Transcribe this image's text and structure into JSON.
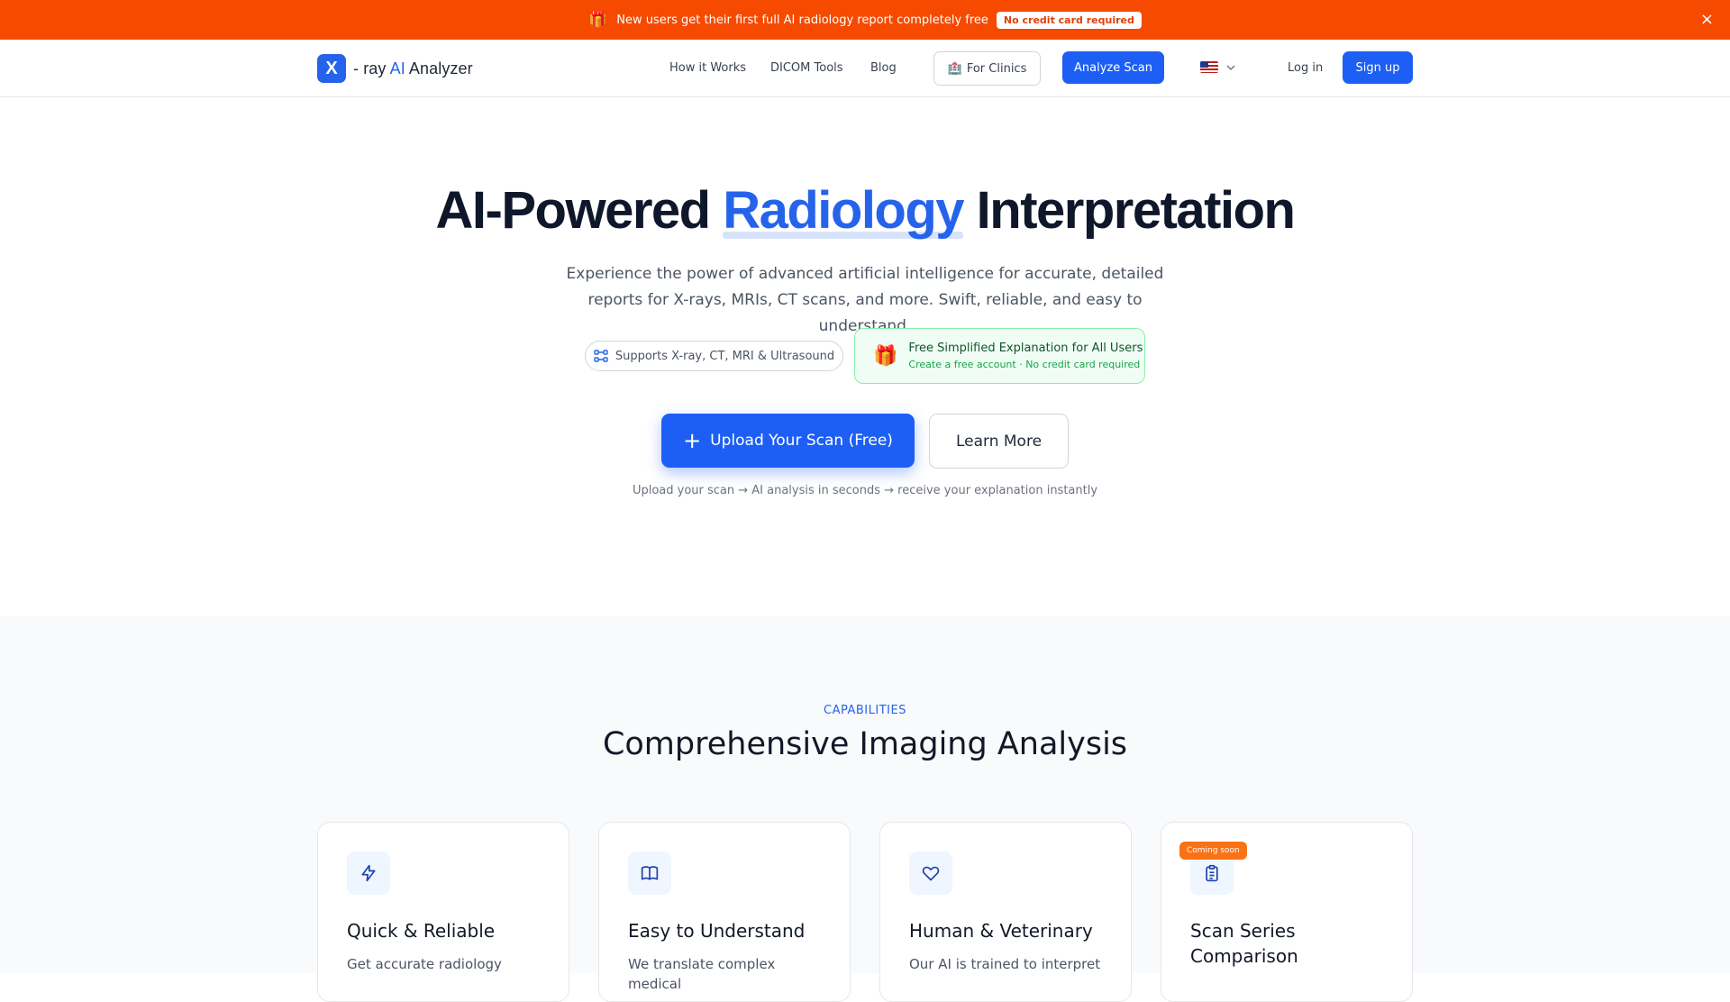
{
  "announcement": {
    "text": "New users get their first full AI radiology report completely free",
    "badge": "No credit card required",
    "close_glyph": "×"
  },
  "nav": {
    "logo_mark": "X",
    "logo_text_pre": "- ray ",
    "logo_text_ai": "AI",
    "logo_text_post": " Analyzer",
    "links": [
      "How it Works",
      "DICOM Tools",
      "Blog"
    ],
    "clinics_label": "For Clinics",
    "analyze_label": "Analyze Scan",
    "login_label": "Log in",
    "signup_label": "Sign up"
  },
  "hero": {
    "title_pre": "AI-Powered ",
    "title_highlight": "Radiology",
    "title_post": " Interpretation",
    "subtitle": "Experience the power of advanced artificial intelligence for accurate, detailed reports for X-rays, MRIs, CT scans, and more. Swift, reliable, and easy to understand.",
    "support_pill": "Supports X-ray, CT, MRI & Ultrasound",
    "free_title": "Free Simplified Explanation for All Users",
    "free_sub": "Create a free account · No credit card required",
    "upload_label": "Upload Your Scan (Free)",
    "learn_label": "Learn More",
    "note": "Upload your scan → AI analysis in seconds → receive your explanation instantly"
  },
  "capabilities": {
    "eyebrow": "CAPABILITIES",
    "title": "Comprehensive Imaging Analysis",
    "cards": [
      {
        "icon": "lightning-icon",
        "title": "Quick & Reliable",
        "desc": "Get accurate radiology"
      },
      {
        "icon": "book-icon",
        "title": "Easy to Understand",
        "desc": "We translate complex medical"
      },
      {
        "icon": "heart-icon",
        "title": "Human & Veterinary",
        "desc": "Our AI is trained to interpret"
      },
      {
        "icon": "clipboard-icon",
        "title": "Scan Series Comparison",
        "desc": "",
        "badge": "Coming soon"
      }
    ]
  },
  "colors": {
    "announce_bg": "#f54a00",
    "primary": "#1d5ff5",
    "brand_blue": "#2563eb",
    "success_bg": "#f0fdf4",
    "soon_badge": "#f97316"
  }
}
